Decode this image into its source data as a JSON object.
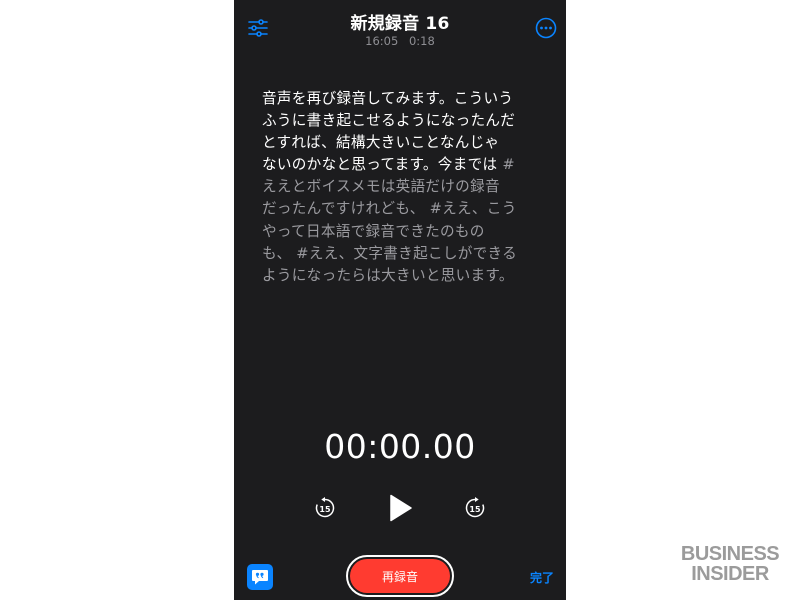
{
  "header": {
    "title": "新規録音 16",
    "time": "16:05",
    "duration": "0:18",
    "settings_icon": "sliders-icon",
    "more_icon": "ellipsis-circle-icon"
  },
  "transcript": {
    "spoken": "音声を再び録音してみます。こういう\nふうに書き起こせるようになったんだ\nとすれば、結構大きいことなんじゃ\nないのかなと思ってます。今までは",
    "pending": " #\nええとボイスメモは英語だけの録音\nだったんですけれども、 #ええ、こう\nやって日本語で録音できたのもの\nも、 #ええ、文字書き起こしができる\nようになったらは大きいと思います。"
  },
  "player": {
    "timer": "00:00.00",
    "skip_back_label": "15",
    "skip_forward_label": "15"
  },
  "footer": {
    "rerecord_label": "再録音",
    "done_label": "完了",
    "transcript_icon": "quote-bubble-icon"
  },
  "watermark": {
    "line1": "BUSINESS",
    "line2": "INSIDER"
  },
  "colors": {
    "background": "#1c1c1e",
    "accent": "#0a84ff",
    "record": "#ff3b30",
    "text_dim": "#9a9a9f"
  }
}
